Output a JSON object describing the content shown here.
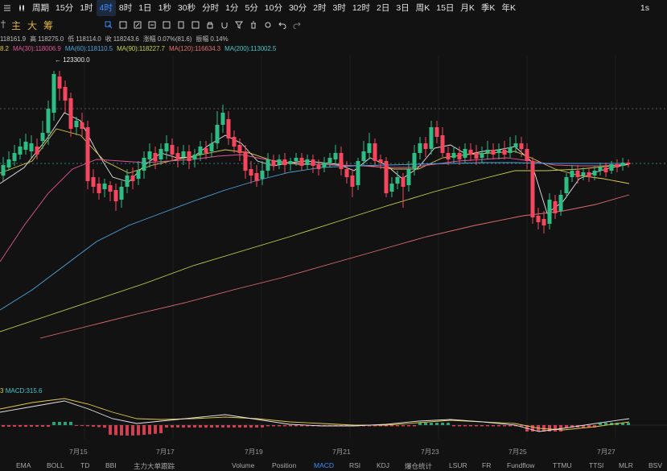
{
  "toolbar": {
    "period_label": "周期",
    "intervals": [
      "15分",
      "1时",
      "4时",
      "8时",
      "1日",
      "1秒",
      "30秒",
      "分时",
      "1分",
      "5分",
      "10分",
      "30分",
      "2时",
      "3时",
      "12时",
      "2日",
      "3日",
      "周K",
      "15日",
      "月K",
      "季K",
      "年K"
    ],
    "active_interval": "4时",
    "right_label": "1s"
  },
  "drawing_tools": [
    "主",
    "大",
    "筹"
  ],
  "info": {
    "ohlc": [
      "118161.9",
      "高 118275.0",
      "低 118114.0",
      "收 118243.6",
      "涨幅 0.07%(81.6)",
      "振幅 0.14%"
    ],
    "ma": [
      {
        "text": "8.2",
        "color": "#e3c94a"
      },
      {
        "text": "MA(30):118006.9",
        "color": "#e0559a"
      },
      {
        "text": "MA(60):118110.5",
        "color": "#4aa3e0"
      },
      {
        "text": "MA(90):118227.7",
        "color": "#c8d04a"
      },
      {
        "text": "MA(120):116634.3",
        "color": "#e46e6e"
      },
      {
        "text": "MA(200):113002.5",
        "color": "#45c8c8"
      }
    ]
  },
  "chart": {
    "high_marker": "123300.0",
    "macd_prefix": "3",
    "macd_label": "MACD:315.6",
    "dates": [
      "7月15",
      "7月17",
      "7月19",
      "7月21",
      "7月23",
      "7月25",
      "7月27"
    ],
    "colors": {
      "up": "#2ebd85",
      "down": "#f6465d",
      "ma5": "#e6e6e6",
      "ma10": "#e3c94a",
      "ma30": "#e0559a",
      "ma60": "#4aa3e0",
      "ma90": "#c8d04a",
      "ma120": "#e46e6e"
    }
  },
  "bottom_tabs": [
    "EMA",
    "BOLL",
    "TD",
    "BBI",
    "主力大单跟踪",
    "Volume",
    "Position",
    "MACD",
    "RSI",
    "KDJ",
    "爆仓统计",
    "LSUR",
    "FR",
    "Fundflow",
    "TTMU",
    "TTSI",
    "MLR",
    "BSV"
  ],
  "active_bottom_tab": "MACD"
}
